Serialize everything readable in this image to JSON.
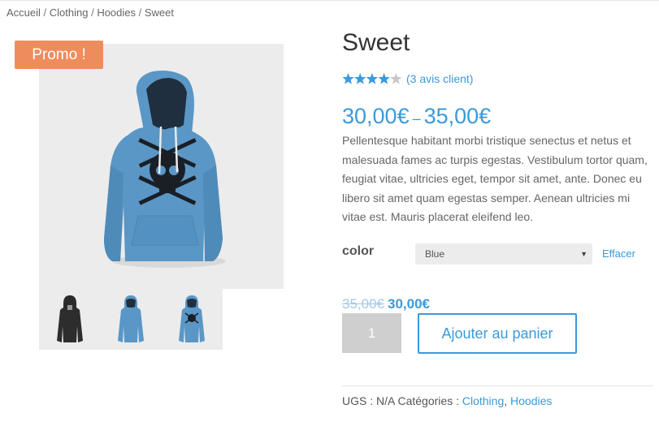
{
  "breadcrumb": {
    "home": "Accueil",
    "separator": " / ",
    "clothing": "Clothing",
    "hoodies": "Hoodies",
    "current": "Sweet"
  },
  "badge": {
    "promo": "Promo !"
  },
  "product": {
    "title": "Sweet",
    "rating_value": 4,
    "rating_max": 5,
    "reviews_link": "(3 avis client)",
    "price_min": "30,00€",
    "price_sep": "–",
    "price_max": "35,00€",
    "description": "Pellentesque habitant morbi tristique senectus et netus et malesuada fames ac turpis egestas. Vestibulum tortor quam, feugiat vitae, ultricies eget, tempor sit amet, ante. Donec eu libero sit amet quam egestas semper. Aenean ultricies mi vitae est. Mauris placerat eleifend leo."
  },
  "variation": {
    "label": "color",
    "selected": "Blue",
    "clear_label": "Effacer",
    "old_price": "35,00€",
    "new_price": "30,00€"
  },
  "cart": {
    "quantity": "1",
    "add_button": "Ajouter au panier"
  },
  "meta": {
    "sku_label": "UGS :",
    "sku_value": "N/A",
    "categories_label": "Catégories :",
    "category_1": "Clothing",
    "category_sep": ",",
    "category_2": "Hoodies"
  },
  "gallery": {
    "main_image": "blue-skull-hoodie",
    "thumbnails": [
      "black-hoodie",
      "blue-hoodie",
      "blue-skull-hoodie"
    ]
  },
  "colors": {
    "accent": "#3b9ad9",
    "promo_badge": "#ef8c5d",
    "hoodie_blue": "#5a97c6",
    "star": "#3b9ad9"
  }
}
